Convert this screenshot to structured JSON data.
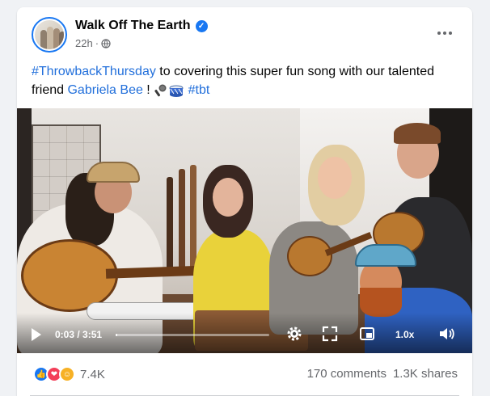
{
  "post": {
    "page_name": "Walk Off The Earth",
    "time": "22h",
    "separator": "·",
    "caption": {
      "hashtag_1": "#ThrowbackThursday",
      "text_1": " to covering this super fun song with our talented friend ",
      "mention": "Gabriela Bee",
      "text_2": " ! ",
      "emoji_icons": [
        "microphone-icon",
        "drum-icon"
      ],
      "hashtag_2": "#tbt"
    }
  },
  "video": {
    "time_display": "0:03 / 3:51",
    "progress": 0.013,
    "speed": "1.0x"
  },
  "footer": {
    "reaction_icons": [
      "like-icon",
      "love-icon",
      "care-icon"
    ],
    "reaction_count": "7.4K",
    "comments": "170 comments",
    "shares": "1.3K shares"
  },
  "colors": {
    "link": "#216fdb",
    "verified": "#1877f2",
    "meta": "#65676b"
  }
}
